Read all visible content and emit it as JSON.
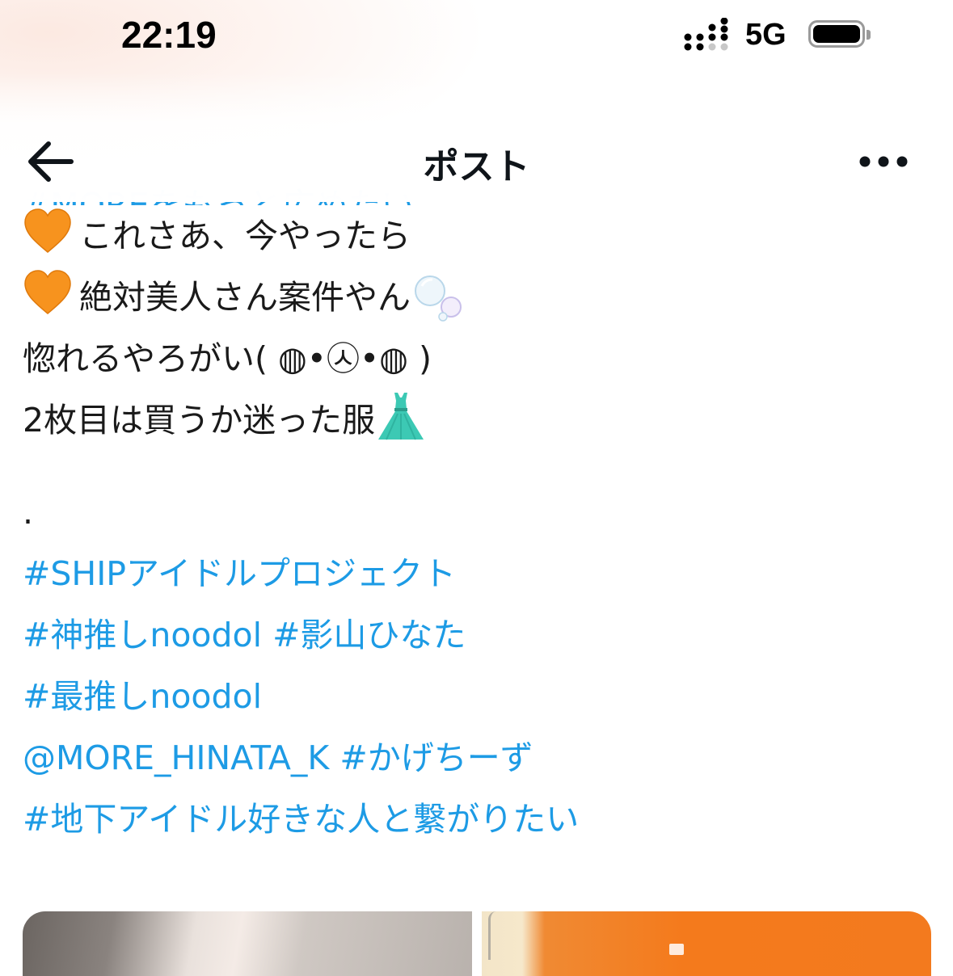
{
  "status_bar": {
    "time": "22:19",
    "network": "5G"
  },
  "header": {
    "title": "ポスト",
    "back_icon": "arrow-left-icon",
    "more_icon": "more-horizontal-icon"
  },
  "post": {
    "clipped_hashtag": "#MOREをもっと広めたい",
    "lines": [
      "これさあ、今やったら",
      "絶対美人さん案件やん",
      "惚れるやろがい( ◍•㉦•◍ )",
      "2枚目は買うか迷った服",
      "."
    ],
    "hashtags": {
      "ship": "#SHIPアイドルプロジェクト",
      "kamioshi": "#神推しnoodol",
      "kageyama": "#影山ひなた",
      "saioshi": "#最推しnoodol",
      "mention": "@MORE_HINATA_K",
      "kagechizu": "#かげちーず",
      "chika": "#地下アイドル好きな人と繋がりたい"
    },
    "emojis": {
      "heart": "orange-heart",
      "bubbles": "bubbles",
      "dress": "dress"
    }
  },
  "colors": {
    "link": "#1d9be5",
    "text": "#1a1a1a",
    "heart": "#f7931e",
    "dress": "#3cc9b4"
  }
}
